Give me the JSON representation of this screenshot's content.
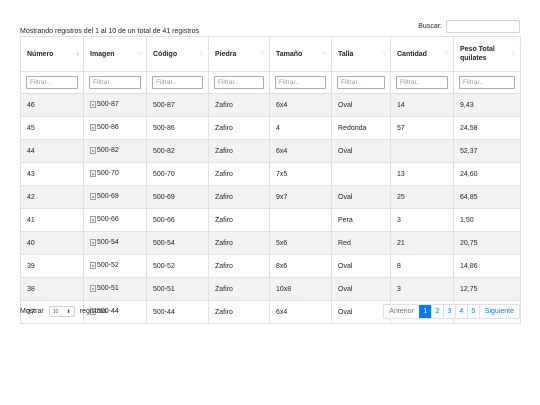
{
  "info_text": "Mostrando registros del 1 al 10 de un total de 41 registros",
  "search": {
    "label": "Buscar:",
    "value": ""
  },
  "columns": [
    {
      "label": "Número",
      "sort": "↓",
      "sort_active": true
    },
    {
      "label": "Imagen",
      "sort": "↑↓",
      "sort_active": false
    },
    {
      "label": "Código",
      "sort": "↑↓",
      "sort_active": false
    },
    {
      "label": "Piedra",
      "sort": "↑↓",
      "sort_active": false
    },
    {
      "label": "Tamaño",
      "sort": "↑↓",
      "sort_active": false
    },
    {
      "label": "Talla",
      "sort": "↑↓",
      "sort_active": false
    },
    {
      "label": "Cantidad",
      "sort": "↑↓",
      "sort_active": false
    },
    {
      "label": "Peso Total quilates",
      "sort": "↑↓",
      "sort_active": false
    }
  ],
  "filter_placeholder": "Filtrar..",
  "rows": [
    {
      "numero": "46",
      "imagen": "500-87",
      "codigo": "500-87",
      "piedra": "Zafiro",
      "tamano": "6x4",
      "talla": "Oval",
      "cantidad": "14",
      "peso": "9,43"
    },
    {
      "numero": "45",
      "imagen": "500-86",
      "codigo": "500-86",
      "piedra": "Zafiro",
      "tamano": "4",
      "talla": "Redonda",
      "cantidad": "57",
      "peso": "24,58"
    },
    {
      "numero": "44",
      "imagen": "500-82",
      "codigo": "500-82",
      "piedra": "Zafiro",
      "tamano": "6x4",
      "talla": "Oval",
      "cantidad": "",
      "peso": "52,37"
    },
    {
      "numero": "43",
      "imagen": "500-70",
      "codigo": "500-70",
      "piedra": "Zafiro",
      "tamano": "7x5",
      "talla": "",
      "cantidad": "13",
      "peso": "24,60"
    },
    {
      "numero": "42",
      "imagen": "500-69",
      "codigo": "500-69",
      "piedra": "Zafiro",
      "tamano": "9x7",
      "talla": "Oval",
      "cantidad": "25",
      "peso": "64,85"
    },
    {
      "numero": "41",
      "imagen": "500-66",
      "codigo": "500-66",
      "piedra": "Zafiro",
      "tamano": "",
      "talla": "Pera",
      "cantidad": "3",
      "peso": "1,50"
    },
    {
      "numero": "40",
      "imagen": "500-54",
      "codigo": "500-54",
      "piedra": "Zafiro",
      "tamano": "5x6",
      "talla": "Red",
      "cantidad": "21",
      "peso": "20,75"
    },
    {
      "numero": "39",
      "imagen": "500-52",
      "codigo": "500-52",
      "piedra": "Zafiro",
      "tamano": "8x6",
      "talla": "Oval",
      "cantidad": "8",
      "peso": "14,86"
    },
    {
      "numero": "38",
      "imagen": "500-51",
      "codigo": "500-51",
      "piedra": "Zafiro",
      "tamano": "10x8",
      "talla": "Oval",
      "cantidad": "3",
      "peso": "12,75"
    },
    {
      "numero": "37",
      "imagen": "500-44",
      "codigo": "500-44",
      "piedra": "Zafiro",
      "tamano": "6x4",
      "talla": "Oval",
      "cantidad": "",
      "peso": "49,90"
    }
  ],
  "length": {
    "prefix": "Mostrar",
    "value": "10",
    "suffix": "registros"
  },
  "pagination": {
    "prev": "Anterior",
    "pages": [
      "1",
      "2",
      "3",
      "4",
      "5"
    ],
    "active_page": "1",
    "next": "Siguiente"
  },
  "colors": {
    "accent": "#007bff",
    "stripe": "#f2f2f2",
    "border": "#dee2e6"
  }
}
